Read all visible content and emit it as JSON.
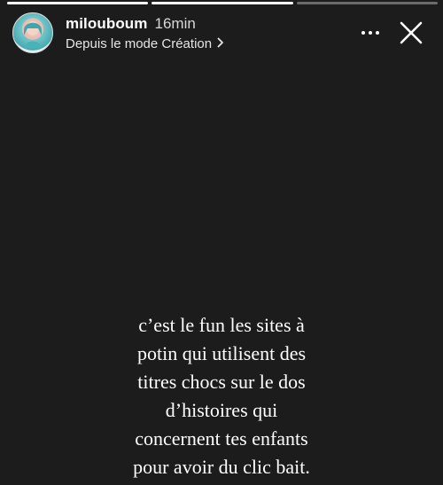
{
  "story": {
    "progress": [
      1.0,
      1.0,
      0.0
    ]
  },
  "header": {
    "username": "miloubouм",
    "time": "16min",
    "subtitle": "Depuis le mode Création",
    "chevron_icon": "chevron-right-icon",
    "more_icon": "more-horizontal-icon",
    "close_icon": "close-icon"
  },
  "caption": {
    "lines": [
      "c’est le fun les sites à",
      "potin qui utilisent des",
      "titres chocs sur le dos",
      "d’histoires qui",
      "concernent tes enfants",
      "pour avoir du clic bait."
    ]
  },
  "colors": {
    "background": "#1c1c1c",
    "text": "#ffffff"
  }
}
